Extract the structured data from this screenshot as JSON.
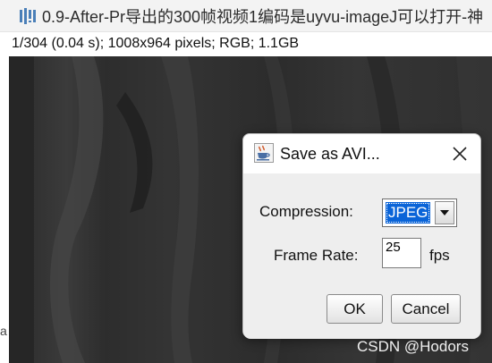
{
  "window": {
    "title": "0.9-After-Pr导出的300帧视频1编码是uyvu-imageJ可以打开-神",
    "app_icon": "imagej-icon"
  },
  "image_info": "1/304 (0.04 s); 1008x964 pixels; RGB; 1.1GB",
  "left_edge_glyph": "a",
  "dialog": {
    "title": "Save as AVI...",
    "icon": "java-coffee-cup-icon",
    "close_icon": "close-x-icon",
    "compression": {
      "label": "Compression:",
      "selected": "JPEG"
    },
    "frame_rate": {
      "label": "Frame Rate:",
      "value": "25",
      "unit": "fps"
    },
    "ok_label": "OK",
    "cancel_label": "Cancel"
  },
  "watermark": "CSDN @Hodors",
  "colors": {
    "selection_blue": "#0a64d8",
    "titlebar": "#f3f3f3",
    "dialog_body": "#eeeeee"
  }
}
